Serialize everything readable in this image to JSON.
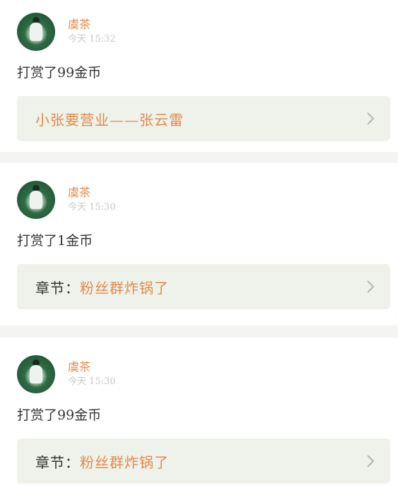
{
  "feed": [
    {
      "user": "虞茶",
      "time": "今天 15:32",
      "message": "打赏了99金币",
      "link_label": "",
      "link_value": "小张要营业——张云雷"
    },
    {
      "user": "虞茶",
      "time": "今天 15:30",
      "message": "打赏了1金币",
      "link_label": "章节：",
      "link_value": "粉丝群炸锅了"
    },
    {
      "user": "虞茶",
      "time": "今天 15:30",
      "message": "打赏了99金币",
      "link_label": "章节：",
      "link_value": "粉丝群炸锅了"
    }
  ],
  "colors": {
    "accent": "#e08a4e",
    "link_bg": "#eff2ea",
    "page_bg": "#f4f5f3"
  },
  "icons": {
    "avatar": "user-avatar",
    "chevron": "chevron-right-icon"
  }
}
